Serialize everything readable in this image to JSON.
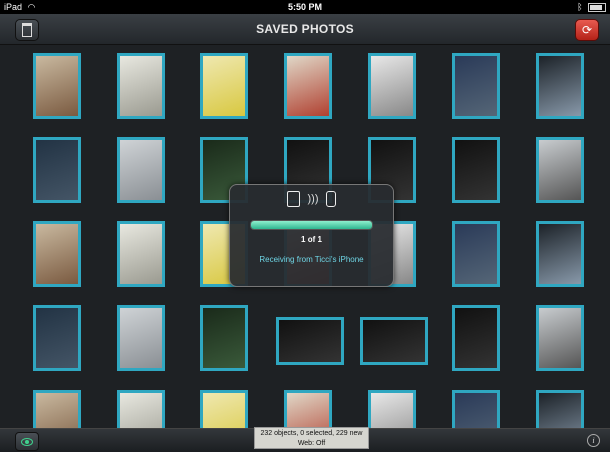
{
  "status_bar": {
    "device": "iPad",
    "wifi_icon": "wifi-icon",
    "time": "5:50 PM",
    "bluetooth_icon": "bluetooth-icon",
    "battery_icon": "battery-icon"
  },
  "nav": {
    "title": "SAVED PHOTOS",
    "left_icon": "trash-icon",
    "right_icon": "sync-icon"
  },
  "transfer": {
    "count_text": "1 of 1",
    "message": "Receiving from Ticci's iPhone",
    "progress_fraction": 1.0,
    "accent": "#2fb58f"
  },
  "toolbar": {
    "status_line1": "232 objects, 0 selected, 229 new",
    "status_line2": "Web: Off",
    "info_label": "i",
    "eye_icon": "eye-icon"
  },
  "colors": {
    "thumb_border": "#2fa7c1",
    "sync_button": "#d03a2f"
  }
}
